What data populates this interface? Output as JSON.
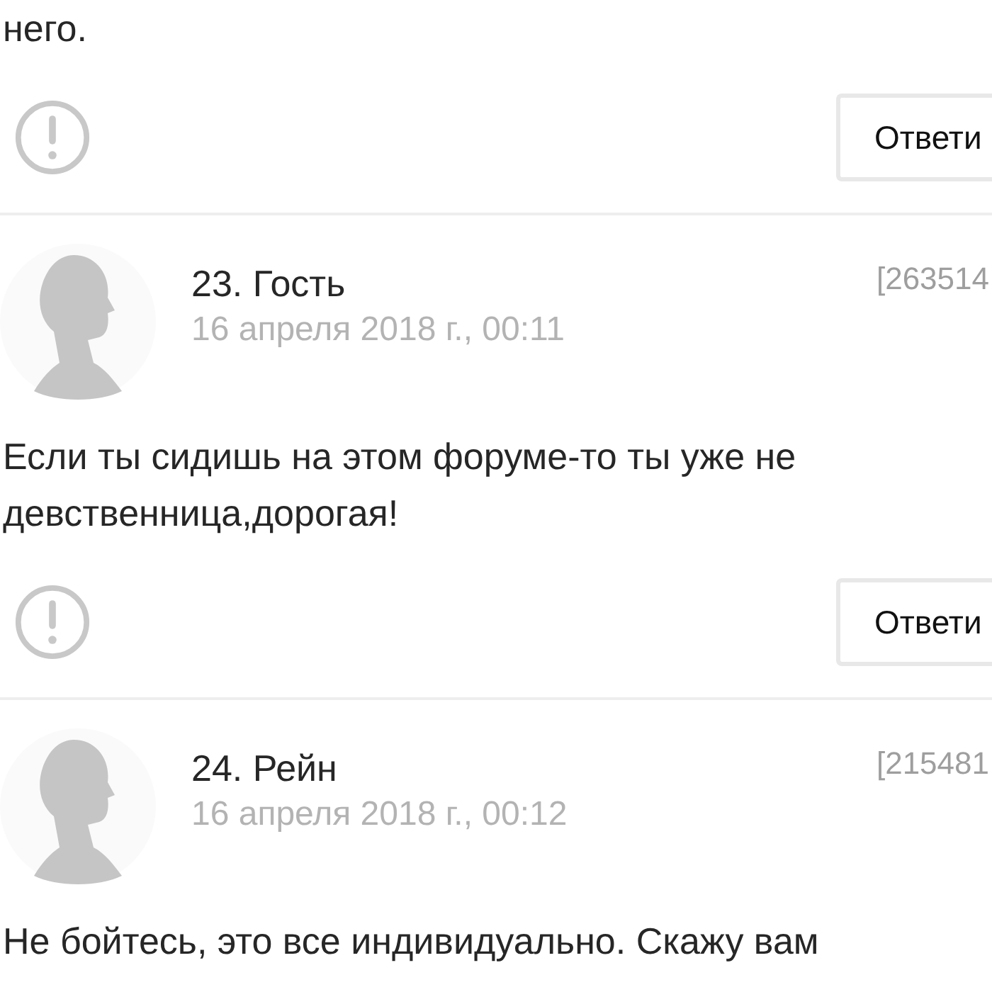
{
  "previous_text_tail": "него.",
  "previous_actions": {
    "reply_label": "Ответи"
  },
  "comments": [
    {
      "author": "23. Гость",
      "date": "16 апреля 2018 г., 00:11",
      "number": "[263514",
      "text": "Если ты сидишь на этом форуме-то ты уже не девственница,дорогая!",
      "reply_label": "Ответи"
    },
    {
      "author": "24. Рейн",
      "date": "16 апреля 2018 г., 00:12",
      "number": "[215481",
      "text": "Не бойтесь, это все индивидуально. Скажу вам"
    }
  ]
}
